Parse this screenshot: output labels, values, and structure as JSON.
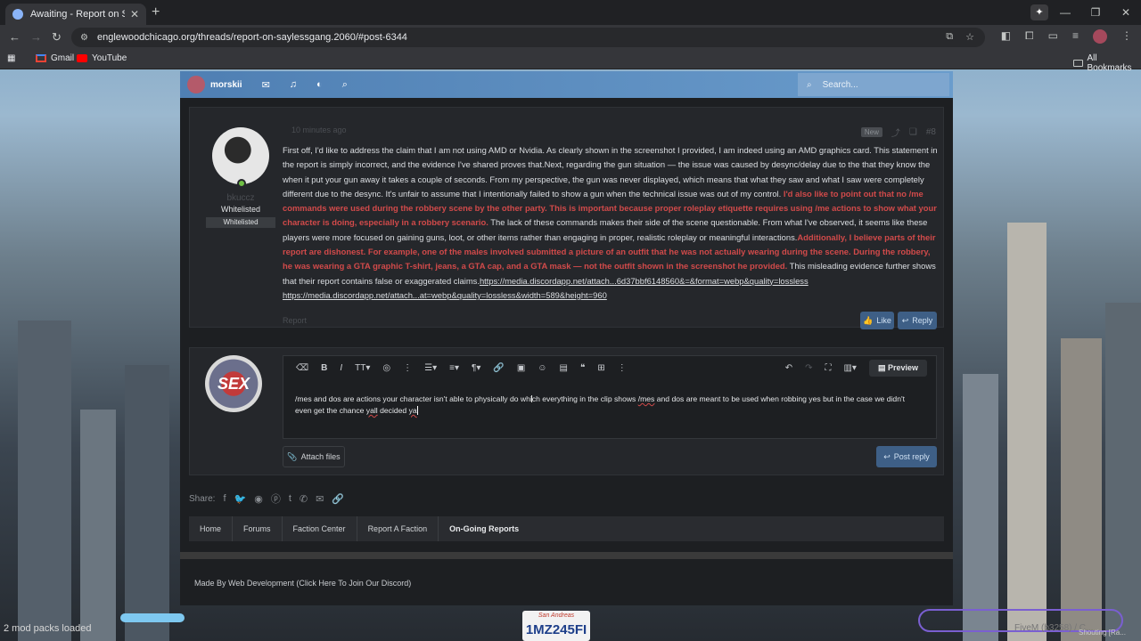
{
  "browser": {
    "tab_title": "Awaiting - Report on Saylessgang...",
    "url": "englewoodchicago.org/threads/report-on-saylessgang.2060/#post-6344",
    "bookmarks": [
      "Gmail",
      "YouTube"
    ],
    "all_bookmarks": "All Bookmarks"
  },
  "forum_nav": {
    "username": "morskii",
    "search_placeholder": "Search..."
  },
  "post": {
    "time": "10 minutes ago",
    "new_badge": "New",
    "post_number": "#8",
    "author": "bkuccz",
    "user_title": "Whitelisted",
    "user_banner": "Whitelisted",
    "p1": "First off, I'd like to address the claim that I am not using AMD or Nvidia. As clearly shown in the screenshot I provided, I am indeed using an AMD graphics card. This statement in the report is simply incorrect, and the evidence I've shared proves that.Next, regarding the gun situation — the issue was caused by desync/delay due to the that they know the when it put your gun away it takes a couple of seconds. From my perspective, the gun was never displayed, which means that what they saw and what I saw were completely different due to the desync. It's unfair to assume that I intentionally failed to show a gun when the technical issue was out of my control.",
    "red1": "I'd also like to point out that no /me commands were used during the robbery scene by the other party. This is important because proper roleplay etiquette requires using /me actions to show what your character is doing, especially in a robbery scenario.",
    "p2": " The lack of these commands makes their side of the scene questionable. From what I've observed, it seems like these players were more focused on gaining guns, loot, or other items rather than engaging in proper, realistic roleplay or meaningful interactions.",
    "red2": "Additionally, I believe parts of their report are dishonest. For example, one of the males involved submitted a picture of an outfit that he was not actually wearing during the scene. During the robbery, he was wearing a GTA graphic T-shirt, jeans, a GTA cap, and a GTA mask — not the outfit shown in the screenshot he provided.",
    "p3": " This misleading evidence further shows that their report contains false or exaggerated claims.",
    "link1": "https://media.discordapp.net/attach...6d37bbf6148560&=&format=webp&quality=lossless",
    "link2": "https://media.discordapp.net/attach...at=webp&quality=lossless&width=589&height=960",
    "report": "Report",
    "like": "Like",
    "reply": "Reply"
  },
  "editor": {
    "avatar_text": "SEX",
    "preview": "Preview",
    "text_a": "/mes and dos are actions your character isn't able to physically do which everything in the clip shows ",
    "text_b": "/mes",
    "text_c": " and dos are meant to be used when robbing yes but in the case we didn't even get the chance ",
    "text_d": "yall",
    "text_e": " decided ",
    "text_f": "ya",
    "attach": "Attach files",
    "post_reply": "Post reply"
  },
  "share_label": "Share:",
  "breadcrumbs": [
    "Home",
    "Forums",
    "Faction Center",
    "Report A Faction",
    "On-Going Reports"
  ],
  "footer": "Made By Web Development (Click Here To Join Our Discord)",
  "overlay": {
    "modpacks": "2 mod packs loaded",
    "plate_state": "San Andreas",
    "plate": "1MZ245FI",
    "fivem": "FiveM (b3258) / C...",
    "shouting": "Shouting [Ra..."
  }
}
